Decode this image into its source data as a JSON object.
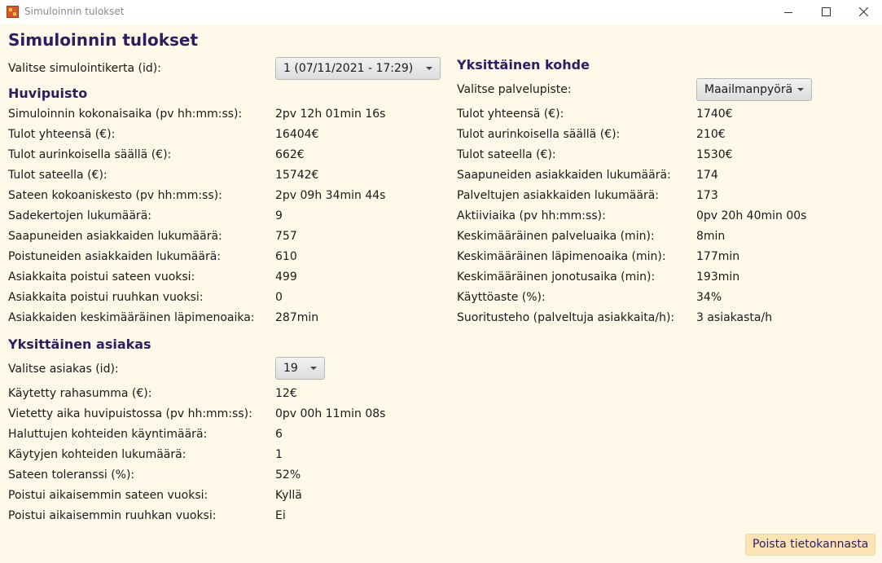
{
  "window": {
    "title": "Simuloinnin tulokset"
  },
  "page_title": "Simuloinnin tulokset",
  "run_select": {
    "label": "Valitse simulointikerta (id):",
    "value": "1 (07/11/2021 - 17:29)"
  },
  "park": {
    "heading": "Huvipuisto",
    "rows": [
      {
        "label": "Simuloinnin kokonaisaika (pv hh:mm:ss):",
        "value": "2pv 12h 01min 16s"
      },
      {
        "label": "Tulot yhteensä (€):",
        "value": "16404€"
      },
      {
        "label": "Tulot aurinkoisella säällä (€):",
        "value": "662€"
      },
      {
        "label": "Tulot sateella (€):",
        "value": "15742€"
      },
      {
        "label": "Sateen kokoaniskesto (pv hh:mm:ss):",
        "value": "2pv 09h 34min 44s"
      },
      {
        "label": "Sadekertojen lukumäärä:",
        "value": "9"
      },
      {
        "label": "Saapuneiden asiakkaiden lukumäärä:",
        "value": "757"
      },
      {
        "label": "Poistuneiden asiakkaiden lukumäärä:",
        "value": "610"
      },
      {
        "label": "Asiakkaita poistui sateen vuoksi:",
        "value": "499"
      },
      {
        "label": "Asiakkaita poistui ruuhkan vuoksi:",
        "value": "0"
      },
      {
        "label": "Asiakkaiden keskimääräinen läpimenoaika:",
        "value": "287min"
      }
    ]
  },
  "customer": {
    "heading": "Yksittäinen asiakas",
    "select": {
      "label": "Valitse asiakas (id):",
      "value": "19"
    },
    "rows": [
      {
        "label": "Käytetty rahasumma (€):",
        "value": "12€"
      },
      {
        "label": "Vietetty aika huvipuistossa (pv hh:mm:ss):",
        "value": "0pv 00h 11min 08s"
      },
      {
        "label": "Haluttujen kohteiden käyntimäärä:",
        "value": "6"
      },
      {
        "label": "Käytyjen kohteiden lukumäärä:",
        "value": "1"
      },
      {
        "label": "Sateen toleranssi (%):",
        "value": "52%"
      },
      {
        "label": "Poistui aikaisemmin sateen vuoksi:",
        "value": "Kyllä"
      },
      {
        "label": "Poistui aikaisemmin ruuhkan vuoksi:",
        "value": "Ei"
      }
    ]
  },
  "target": {
    "heading": "Yksittäinen kohde",
    "select": {
      "label": "Valitse palvelupiste:",
      "value": "Maailmanpyörä"
    },
    "rows": [
      {
        "label": "Tulot yhteensä (€):",
        "value": "1740€"
      },
      {
        "label": "Tulot aurinkoisella säällä (€):",
        "value": "210€"
      },
      {
        "label": "Tulot sateella (€):",
        "value": "1530€"
      },
      {
        "label": "Saapuneiden asiakkaiden lukumäärä:",
        "value": "174"
      },
      {
        "label": "Palveltujen asiakkaiden lukumäärä:",
        "value": "173"
      },
      {
        "label": "Aktiiviaika (pv hh:mm:ss):",
        "value": "0pv 20h 40min 00s"
      },
      {
        "label": "Keskimääräinen palveluaika (min):",
        "value": "8min"
      },
      {
        "label": "Keskimääräinen läpimenoaika (min):",
        "value": "177min"
      },
      {
        "label": "Keskimääräinen jonotusaika (min):",
        "value": "193min"
      },
      {
        "label": "Käyttöaste (%):",
        "value": "34%"
      },
      {
        "label": "Suoritusteho (palveltuja asiakkaita/h):",
        "value": "3 asiakasta/h"
      }
    ]
  },
  "delete_button": "Poista tietokannasta"
}
